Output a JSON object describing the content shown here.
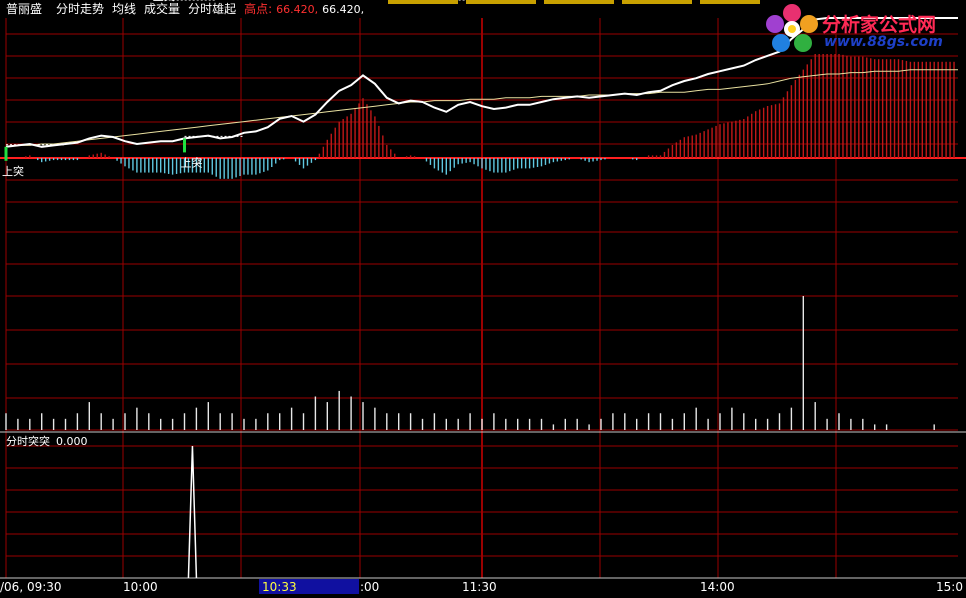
{
  "header": {
    "stock_name": "普丽盛",
    "indicators": [
      "分时走势",
      "均线",
      "成交量",
      "分时雄起"
    ],
    "high_label": "高点:",
    "high_value": "66.420,",
    "high_value2": "66.420,"
  },
  "logo": {
    "text": "分析家公式网",
    "url": "www.88gs.com"
  },
  "sub_panel": {
    "name": "分时突突",
    "value": "0.000"
  },
  "colors": {
    "grid": "#9a0000",
    "baseline": "#ff2020",
    "price_line": "#ffffff",
    "avg_line": "#e8e0a0",
    "up_bar": "#c01818",
    "down_bar": "#60c8e0",
    "signal": "#20e040",
    "volume": "#e8e8e8",
    "header_high": "#ff3030",
    "time_highlight_bg": "#1010a0",
    "time_highlight_text": "#ffff40"
  },
  "time_axis": {
    "labels": [
      "/06, 09:30",
      "10:00",
      "10:33",
      ":00",
      "11:30",
      "14:00",
      "15:0"
    ],
    "highlighted": "10:33"
  },
  "chart_data": {
    "type": "line",
    "x": [
      0,
      3,
      6,
      9,
      12,
      15,
      18,
      21,
      24,
      27,
      30,
      33,
      36,
      39,
      42,
      45,
      48,
      51,
      54,
      57,
      60,
      63,
      66,
      69,
      72,
      75,
      78,
      81,
      84,
      87,
      90,
      93,
      96,
      99,
      102,
      105,
      108,
      111,
      114,
      117,
      120,
      123,
      126,
      129,
      132,
      135,
      138,
      141,
      144,
      147,
      150,
      153,
      156,
      159,
      162,
      165,
      168,
      171,
      174,
      177,
      180,
      183,
      186,
      189,
      192,
      195,
      198,
      201,
      204,
      207,
      210,
      213,
      216,
      219,
      222,
      225,
      228,
      231,
      234,
      237,
      240
    ],
    "series": [
      {
        "values": [
          0.08,
          0.09,
          0.1,
          0.08,
          0.09,
          0.1,
          0.11,
          0.14,
          0.16,
          0.15,
          0.12,
          0.1,
          0.11,
          0.12,
          0.12,
          0.14,
          0.15,
          0.16,
          0.14,
          0.15,
          0.18,
          0.19,
          0.22,
          0.28,
          0.3,
          0.26,
          0.31,
          0.4,
          0.48,
          0.52,
          0.59,
          0.53,
          0.43,
          0.39,
          0.41,
          0.4,
          0.36,
          0.33,
          0.38,
          0.4,
          0.37,
          0.35,
          0.36,
          0.38,
          0.38,
          0.4,
          0.42,
          0.43,
          0.44,
          0.43,
          0.44,
          0.45,
          0.46,
          0.45,
          0.47,
          0.48,
          0.52,
          0.55,
          0.57,
          0.6,
          0.62,
          0.64,
          0.66,
          0.7,
          0.73,
          0.76,
          0.85,
          0.92,
          0.99,
          1.0,
          1.0,
          1.0,
          1.0,
          1.0,
          1.0,
          1.0,
          1.0,
          1.0,
          1.0,
          1.0,
          1.0
        ]
      },
      {
        "values": [
          0.08,
          0.09,
          0.09,
          0.1,
          0.1,
          0.11,
          0.12,
          0.13,
          0.14,
          0.15,
          0.16,
          0.17,
          0.18,
          0.19,
          0.2,
          0.21,
          0.22,
          0.23,
          0.24,
          0.25,
          0.26,
          0.27,
          0.28,
          0.29,
          0.3,
          0.31,
          0.32,
          0.33,
          0.34,
          0.35,
          0.36,
          0.37,
          0.38,
          0.39,
          0.4,
          0.4,
          0.41,
          0.41,
          0.41,
          0.42,
          0.42,
          0.42,
          0.43,
          0.43,
          0.43,
          0.44,
          0.44,
          0.44,
          0.44,
          0.45,
          0.45,
          0.45,
          0.46,
          0.46,
          0.46,
          0.47,
          0.47,
          0.47,
          0.48,
          0.49,
          0.49,
          0.5,
          0.51,
          0.52,
          0.53,
          0.55,
          0.57,
          0.58,
          0.59,
          0.6,
          0.6,
          0.61,
          0.61,
          0.62,
          0.62,
          0.62,
          0.63,
          0.63,
          0.63,
          0.63,
          0.63
        ]
      }
    ],
    "volume": [
      3,
      2,
      2,
      3,
      2,
      2,
      3,
      5,
      3,
      2,
      3,
      4,
      3,
      2,
      2,
      3,
      4,
      5,
      3,
      3,
      2,
      2,
      3,
      3,
      4,
      3,
      6,
      5,
      7,
      6,
      5,
      4,
      3,
      3,
      3,
      2,
      3,
      2,
      2,
      3,
      2,
      3,
      2,
      2,
      2,
      2,
      1,
      2,
      2,
      1,
      2,
      3,
      3,
      2,
      3,
      3,
      2,
      3,
      4,
      2,
      3,
      4,
      3,
      2,
      2,
      3,
      4,
      24,
      5,
      2,
      3,
      2,
      2,
      1,
      1,
      0,
      0,
      0,
      1,
      0,
      0
    ],
    "signals": [
      0,
      38,
      45,
      101
    ],
    "signal_label": "上突",
    "sub_spike_x": 47,
    "ylim": [
      0,
      1
    ],
    "grid": true
  }
}
